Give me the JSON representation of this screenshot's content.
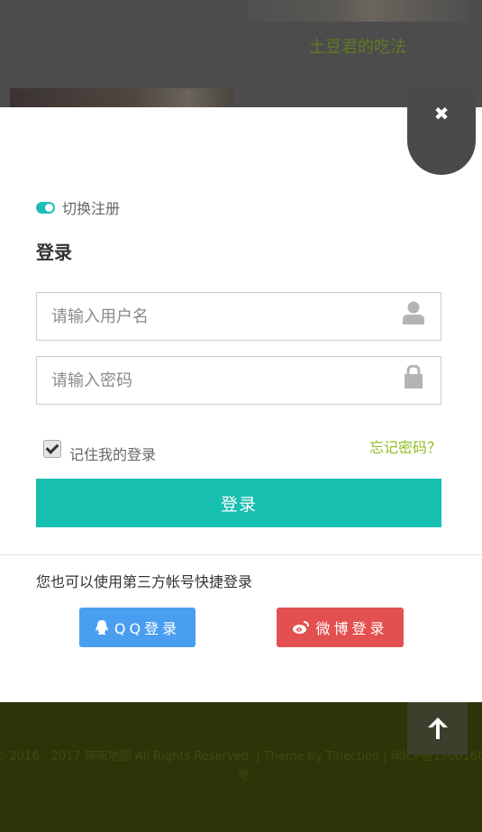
{
  "background": {
    "post_title": "土豆君的吃法",
    "footer_text": "© 2016 - 2017 啄啄地图 All Rights Reserved. | Theme by  Tinection  | 闽ICP备15001602号"
  },
  "modal": {
    "switch_label": "切换注册",
    "title": "登录",
    "username": {
      "placeholder": "请输入用户名",
      "value": ""
    },
    "password": {
      "placeholder": "请输入密码",
      "value": ""
    },
    "remember_label": "记住我的登录",
    "remember_checked": true,
    "forgot_label": "忘记密码？",
    "submit_label": "登录",
    "third_party_text": "您也可以使用第三方帐号快捷登录",
    "qq_label": "QQ登录",
    "weibo_label": "微博登录"
  },
  "colors": {
    "accent": "#17bfb1",
    "forgot_link": "#8fbf22",
    "qq": "#4a9ef0",
    "weibo": "#e2504f"
  },
  "icons": {
    "close": "close-icon",
    "user": "user-icon",
    "lock": "lock-icon",
    "qq": "qq-icon",
    "weibo": "weibo-icon",
    "back_to_top": "arrow-up-icon"
  }
}
